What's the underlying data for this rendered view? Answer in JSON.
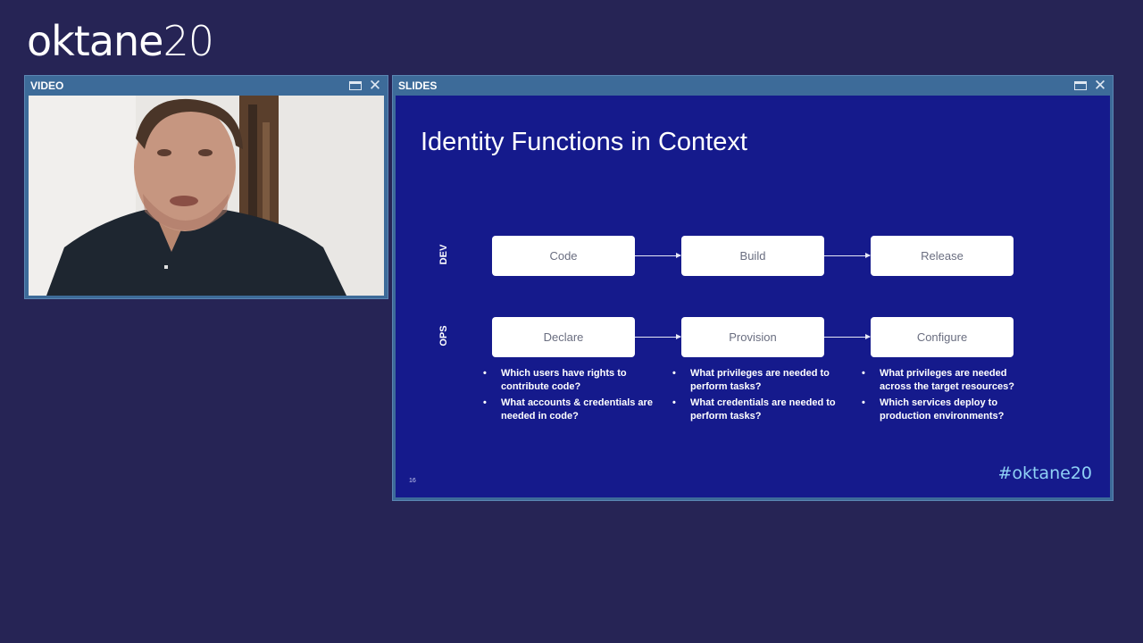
{
  "brand": {
    "name": "oktane",
    "year": "20"
  },
  "video_panel": {
    "title": "VIDEO"
  },
  "slides_panel": {
    "title": "SLIDES"
  },
  "slide": {
    "title": "Identity Functions in Context",
    "rows": [
      {
        "label": "DEV",
        "steps": [
          "Code",
          "Build",
          "Release"
        ]
      },
      {
        "label": "OPS",
        "steps": [
          "Declare",
          "Provision",
          "Configure"
        ]
      }
    ],
    "questions": [
      [
        "Which users have rights to contribute code?",
        "What accounts & credentials are needed in code?"
      ],
      [
        "What privileges are needed to perform tasks?",
        "What credentials are needed to perform tasks?"
      ],
      [
        "What privileges are needed across the target resources?",
        "Which services deploy to production environments?"
      ]
    ],
    "page_number": "16",
    "hashtag": "#oktane20"
  },
  "colors": {
    "background": "#262455",
    "panel_frame": "#3d6b99",
    "slide_background": "#151a8c",
    "hashtag": "#8fd1f5"
  },
  "icons": [
    "maximize-icon",
    "close-icon"
  ]
}
